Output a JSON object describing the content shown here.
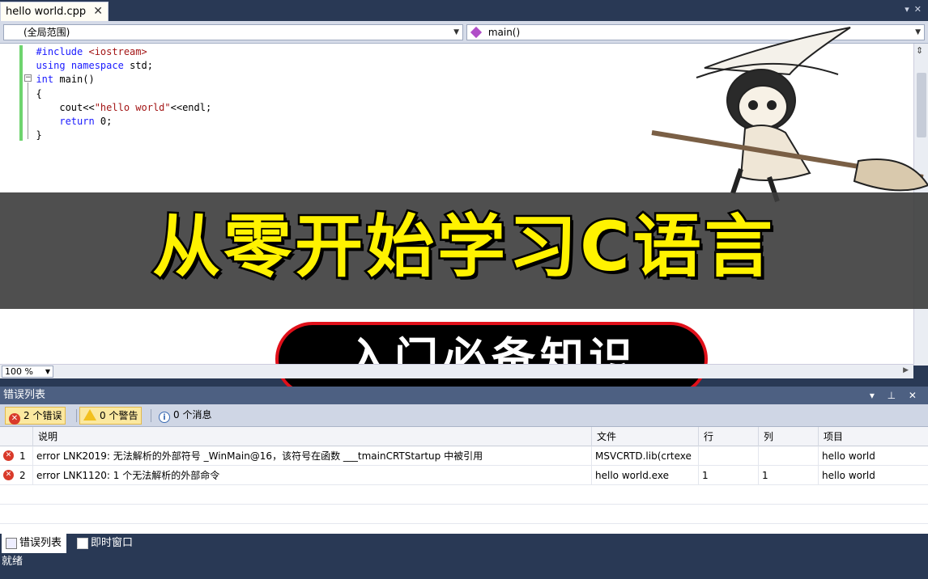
{
  "editor_tab": {
    "title": "hello world.cpp",
    "close": "✕"
  },
  "navbar": {
    "scope": "(全局范围)",
    "member": "main()"
  },
  "code": {
    "l1_pp": "#include ",
    "l1_hdr": "<iostream>",
    "l2_kw1": "using",
    "l2_kw2": "namespace",
    "l2_rest": " std;",
    "l3_kw": "int",
    "l3_rest": " main()",
    "l4": "{",
    "l5_a": "    cout<<",
    "l5_str": "\"hello world\"",
    "l5_b": "<<endl;",
    "l6_kw": "    return",
    "l6_rest": " 0;",
    "l7": "}"
  },
  "banner": {
    "title": "从零开始学习C语言",
    "subtitle": "入门必备知识"
  },
  "zoom": {
    "value": "100 %"
  },
  "error_panel": {
    "title": "错误列表",
    "controls": "▾ ⊥ ✕",
    "filters": {
      "errors": "2 个错误",
      "warnings": "0 个警告",
      "messages": "0 个消息"
    },
    "columns": [
      "说明",
      "文件",
      "行",
      "列",
      "项目"
    ],
    "rows": [
      {
        "num": "1",
        "desc": "error LNK2019: 无法解析的外部符号 _WinMain@16，该符号在函数 ___tmainCRTStartup 中被引用",
        "file": "MSVCRTD.lib(crtexe",
        "line": "",
        "col": "",
        "project": "hello world"
      },
      {
        "num": "2",
        "desc": "error LNK1120: 1 个无法解析的外部命令",
        "file": "hello world.exe",
        "line": "1",
        "col": "1",
        "project": "hello world"
      }
    ]
  },
  "bottom_tabs": {
    "error_list": "错误列表",
    "immediate": "即时窗口"
  },
  "status": {
    "text": "就绪"
  }
}
